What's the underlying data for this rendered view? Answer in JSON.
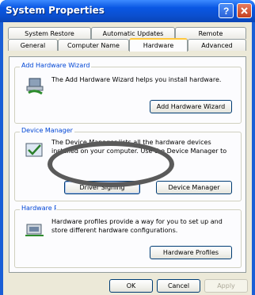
{
  "window": {
    "title": "System Properties"
  },
  "tabs": {
    "row1": [
      "System Restore",
      "Automatic Updates",
      "Remote"
    ],
    "row2": [
      "General",
      "Computer Name",
      "Hardware",
      "Advanced"
    ]
  },
  "hardware_wizard": {
    "group_label": "Add Hardware Wizard",
    "description": "The Add Hardware Wizard helps you install hardware.",
    "button": "Add Hardware Wizard"
  },
  "device_manager": {
    "group_label": "Device Manager",
    "description": "The Device Manager lists all the hardware devices installed on your computer. Use the Device Manager to change the properties of any device.",
    "signing_button": "Driver Signing",
    "button": "Device Manager"
  },
  "hardware_profiles": {
    "group_label": "Hardware Profiles",
    "description": "Hardware profiles provide a way for you to set up and store different hardware configurations.",
    "button": "Hardware Profiles"
  },
  "footer": {
    "ok": "OK",
    "cancel": "Cancel",
    "apply": "Apply"
  },
  "colors": {
    "titlebar": "#0a57e3",
    "group_label": "#0046d5",
    "annotation": "#5a5a5a"
  },
  "icons": [
    "help-icon",
    "close-icon",
    "hardware-wizard-icon",
    "device-manager-icon",
    "hardware-profiles-icon"
  ]
}
